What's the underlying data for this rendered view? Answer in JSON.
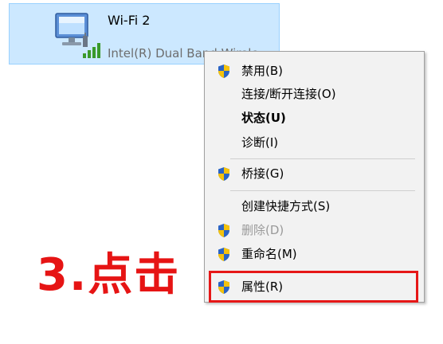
{
  "adapter": {
    "name": "Wi-Fi 2",
    "description": "Intel(R) Dual Band Wirele"
  },
  "menu": {
    "items": [
      {
        "label": "禁用(B)",
        "shield": true,
        "bold": false,
        "disabled": false
      },
      {
        "label": "连接/断开连接(O)",
        "shield": false,
        "bold": false,
        "disabled": false
      },
      {
        "label": "状态(U)",
        "shield": false,
        "bold": true,
        "disabled": false
      },
      {
        "label": "诊断(I)",
        "shield": false,
        "bold": false,
        "disabled": false
      },
      {
        "label": "桥接(G)",
        "shield": true,
        "bold": false,
        "disabled": false
      },
      {
        "label": "创建快捷方式(S)",
        "shield": false,
        "bold": false,
        "disabled": false
      },
      {
        "label": "删除(D)",
        "shield": true,
        "bold": false,
        "disabled": true
      },
      {
        "label": "重命名(M)",
        "shield": true,
        "bold": false,
        "disabled": false
      },
      {
        "label": "属性(R)",
        "shield": true,
        "bold": false,
        "disabled": false
      }
    ]
  },
  "annotation": {
    "text": "3.点击",
    "color": "#e61414"
  },
  "colors": {
    "selection_bg": "#cce8ff",
    "menu_bg": "#f2f2f2",
    "highlight": "#e61717"
  },
  "icons": {
    "adapter": "network-adapter-icon",
    "shield": "uac-shield-icon"
  }
}
